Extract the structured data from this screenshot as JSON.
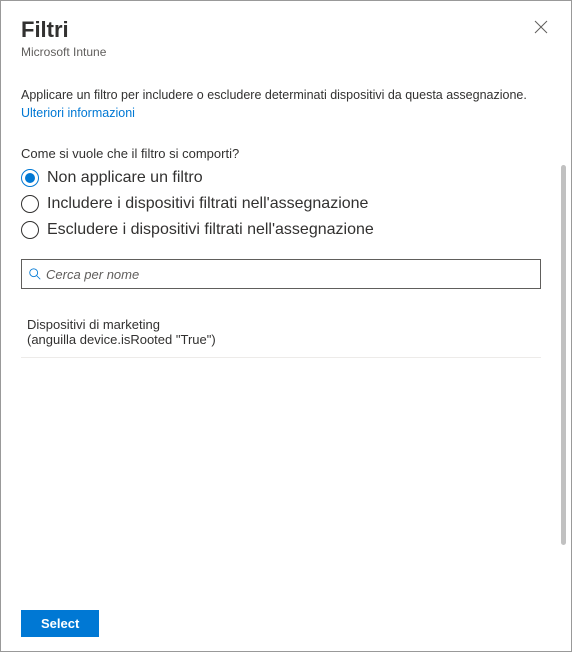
{
  "header": {
    "title": "Filtri",
    "subtitle": "Microsoft Intune"
  },
  "description": {
    "text": "Applicare un filtro per includere o escludere determinati dispositivi da questa assegnazione. ",
    "link": "Ulteriori informazioni"
  },
  "question": "Come si vuole che il filtro si comporti?",
  "options": [
    {
      "label": "Non applicare un filtro",
      "selected": true
    },
    {
      "label": "Includere i dispositivi filtrati nell'assegnazione",
      "selected": false
    },
    {
      "label": "Escludere i dispositivi filtrati nell'assegnazione",
      "selected": false
    }
  ],
  "search": {
    "placeholder": "Cerca per nome"
  },
  "filters": [
    {
      "name": "Dispositivi di marketing",
      "rule": "(anguilla device.isRooted \"True\")"
    }
  ],
  "footer": {
    "select": "Select"
  }
}
